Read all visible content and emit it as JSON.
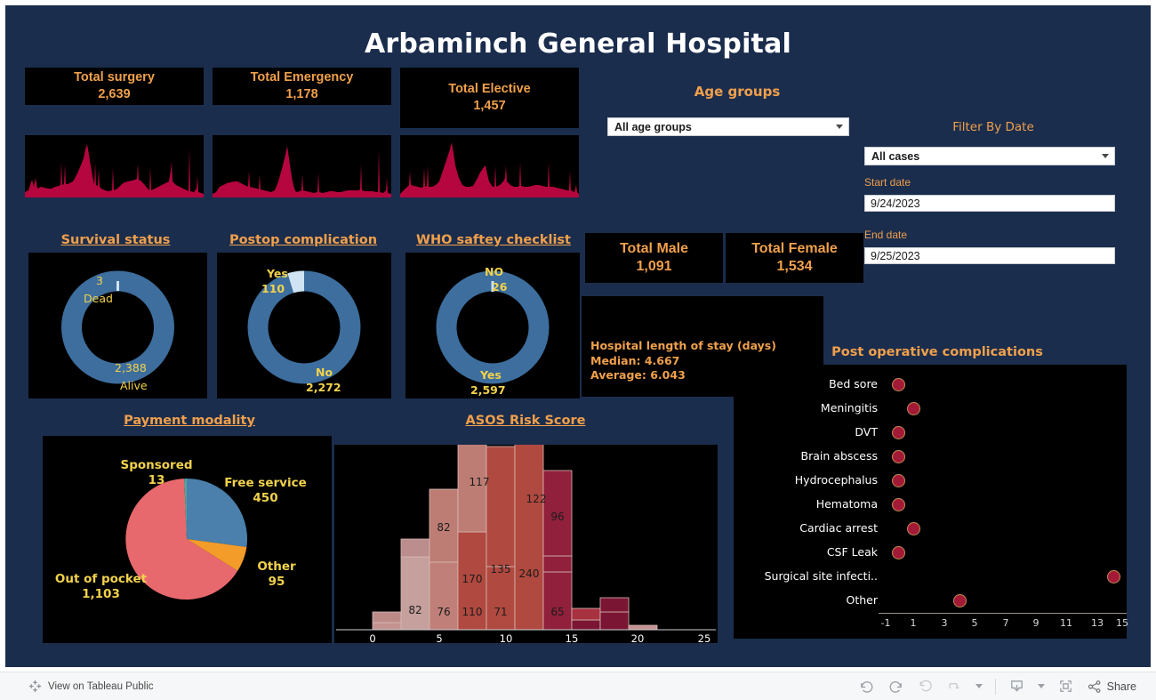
{
  "header": {
    "title": "Arbaminch General Hospital"
  },
  "kpis": [
    {
      "label": "Total surgery",
      "value": "2,639"
    },
    {
      "label": "Total Emergency",
      "value": "1,178"
    },
    {
      "label": "Total Elective",
      "value": "1,457"
    },
    {
      "label": "Total Male",
      "value": "1,091"
    },
    {
      "label": "Total Female",
      "value": "1,534"
    }
  ],
  "filters": {
    "age_groups_heading": "Age groups",
    "age_groups_value": "All age groups",
    "filter_by_date_heading": "Filter By Date",
    "date_mode_value": "All cases",
    "start_date_label": "Start date",
    "start_date_value": "9/24/2023",
    "end_date_label": "End date",
    "end_date_value": "9/25/2023"
  },
  "donuts": [
    {
      "title": "Survival status",
      "segments": [
        {
          "label": "Dead",
          "value": "3",
          "num": 3,
          "color": "#cfe3f2"
        },
        {
          "label": "Alive",
          "value": "2,388",
          "num": 2388,
          "color": "#3d6e9e"
        }
      ]
    },
    {
      "title": "Postop complication",
      "segments": [
        {
          "label": "Yes",
          "value": "110",
          "num": 110,
          "color": "#cfe3f2"
        },
        {
          "label": "No",
          "value": "2,272",
          "num": 2272,
          "color": "#3d6e9e"
        }
      ]
    },
    {
      "title": "WHO saftey checklist",
      "segments": [
        {
          "label": "NO",
          "value": "26",
          "num": 26,
          "color": "#cfe3f2"
        },
        {
          "label": "Yes",
          "value": "2,597",
          "num": 2597,
          "color": "#3d6e9e"
        }
      ]
    }
  ],
  "length_of_stay": {
    "title": "Hospital length of stay (days)",
    "median_label": "Median: 4.667",
    "average_label": "Average: 6.043"
  },
  "chart_data": [
    {
      "type": "pie",
      "title": "Payment modality",
      "categories": [
        "Free service",
        "Other",
        "Out of pocket",
        "Sponsored"
      ],
      "values": [
        450,
        95,
        1103,
        13
      ],
      "colors": [
        "#4a80ab",
        "#f39c2a",
        "#e8696d",
        "#4aa8a0"
      ],
      "labels": [
        {
          "name": "Sponsored",
          "value": "13"
        },
        {
          "name": "Free service",
          "value": "450"
        },
        {
          "name": "Other",
          "value": "95"
        },
        {
          "name": "Out of pocket",
          "value": "1,103"
        }
      ]
    },
    {
      "type": "bar",
      "title": "ASOS Risk Score",
      "xlabel": "",
      "ylabel": "",
      "xlim": [
        -1.5,
        26
      ],
      "ticks": [
        "0",
        "5",
        "10",
        "15",
        "20",
        "25"
      ],
      "tickvals": [
        0,
        5,
        10,
        15,
        20,
        25
      ],
      "bins": [
        {
          "x0": 0,
          "x1": 2,
          "segments": [
            {
              "v": 8,
              "label": "",
              "color": "#c49391"
            },
            {
              "v": 12,
              "label": "",
              "color": "#bc8b88"
            }
          ]
        },
        {
          "x0": 2,
          "x1": 4,
          "segments": [
            {
              "v": 82,
              "label": "82",
              "color": "#c6a09c"
            },
            {
              "v": 20,
              "label": "",
              "color": "#bb8d8c"
            }
          ]
        },
        {
          "x0": 4,
          "x1": 6,
          "segments": [
            {
              "v": 76,
              "label": "76",
              "color": "#c08079"
            },
            {
              "v": 82,
              "label": "82",
              "color": "#bd7d74"
            }
          ]
        },
        {
          "x0": 6,
          "x1": 8,
          "segments": [
            {
              "v": 110,
              "label": "110",
              "color": "#b0493f"
            },
            {
              "v": 170,
              "label": "170",
              "color": "#bd7d74"
            },
            {
              "v": 117,
              "label": "117",
              "color": "#bd7d74"
            }
          ]
        },
        {
          "x0": 8,
          "x1": 10,
          "segments": [
            {
              "v": 71,
              "label": "71",
              "color": "#b0493f"
            },
            {
              "v": 135,
              "label": "135",
              "color": "#b0493f"
            }
          ]
        },
        {
          "x0": 10,
          "x1": 12,
          "segments": [
            {
              "v": 240,
              "label": "240",
              "color": "#b0493f"
            },
            {
              "v": 122,
              "label": "122",
              "color": "#b0493f"
            }
          ]
        },
        {
          "x0": 12,
          "x1": 14,
          "segments": [
            {
              "v": 65,
              "label": "65",
              "color": "#90203b"
            },
            {
              "v": 18,
              "label": "",
              "color": "#90203b"
            },
            {
              "v": 96,
              "label": "96",
              "color": "#90203b"
            }
          ]
        },
        {
          "x0": 14,
          "x1": 16,
          "segments": [
            {
              "v": 11,
              "label": "",
              "color": "#7a1633"
            },
            {
              "v": 13,
              "label": "",
              "color": "#a8313f"
            }
          ]
        },
        {
          "x0": 16,
          "x1": 18,
          "segments": [
            {
              "v": 20,
              "label": "",
              "color": "#7a1633"
            },
            {
              "v": 16,
              "label": "",
              "color": "#7a1633"
            }
          ]
        },
        {
          "x0": 18,
          "x1": 20,
          "segments": [
            {
              "v": 5,
              "label": "",
              "color": "#c49391"
            }
          ]
        }
      ]
    },
    {
      "type": "scatter",
      "title": "Post operative complications",
      "xlabel": "",
      "xlim": [
        -1.6,
        15.4
      ],
      "ticks": [
        "-1",
        "1",
        "3",
        "5",
        "7",
        "9",
        "11",
        "13",
        "15"
      ],
      "tickvals": [
        -1,
        1,
        3,
        5,
        7,
        9,
        11,
        13,
        15
      ],
      "categories": [
        "Bed sore",
        "Meningitis",
        "DVT",
        "Brain abscess",
        "Hydrocephalus",
        "Hematoma",
        "Cardiac arrest",
        "CSF Leak",
        "Surgical site infecti..",
        "Other"
      ],
      "values": [
        0,
        1,
        0,
        0,
        0,
        0,
        1,
        0,
        14,
        4
      ],
      "point_color": "#a31a37"
    }
  ],
  "footer": {
    "view_label": "View on Tableau Public",
    "share_label": "Share",
    "icons": [
      "tableau-logo-icon",
      "undo-icon",
      "redo-icon",
      "revert-icon",
      "refresh-icon",
      "download-icon",
      "fullscreen-icon",
      "share-icon"
    ]
  },
  "colors": {
    "background": "#1b2d4d",
    "panel": "#000000",
    "accent": "#f0a04b",
    "label_yellow": "#f2d24b",
    "donut_main": "#3d6e9e",
    "donut_minor": "#cfe3f2",
    "spark_red": "#b5063f"
  }
}
